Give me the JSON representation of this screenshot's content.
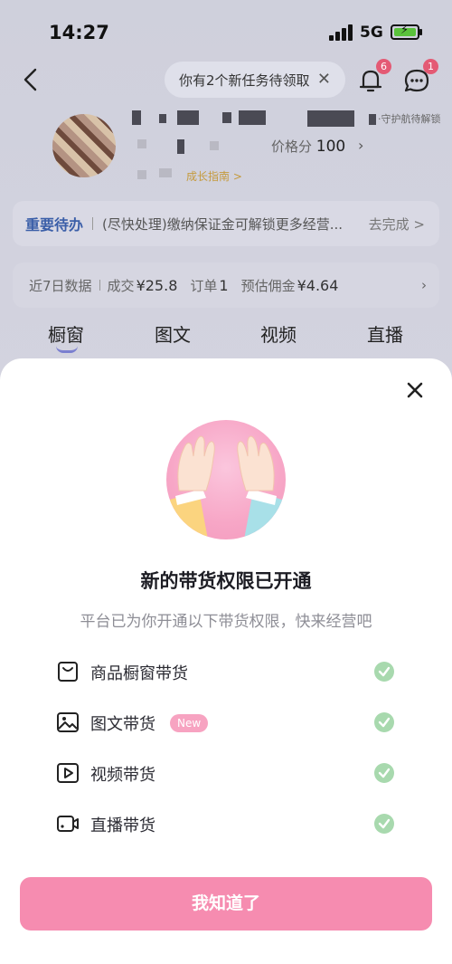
{
  "status_bar": {
    "time": "14:27",
    "network": "5G"
  },
  "header": {
    "task_pill": "你有2个新任务待领取",
    "bell_badge": "6",
    "message_badge": "1"
  },
  "profile": {
    "ambassador": "·守护航待解锁",
    "price_score_label": "价格分",
    "price_score_value": "100",
    "growth_guide": "成长指南 >"
  },
  "todo": {
    "title": "重要待办",
    "text": "(尽快处理)缴纳保证金可解锁更多经营...",
    "action": "去完成 >"
  },
  "stats": {
    "label": "近7日数据",
    "deal_label": "成交",
    "deal_value": "¥25.8",
    "orders_label": "订单",
    "orders_value": "1",
    "commission_label": "预估佣金",
    "commission_value": "¥4.64"
  },
  "tabs": [
    "橱窗",
    "图文",
    "视频",
    "直播"
  ],
  "sheet": {
    "title": "新的带货权限已开通",
    "subtitle": "平台已为你开通以下带货权限，快来经营吧",
    "permissions": [
      {
        "label": "商品橱窗带货",
        "icon": "bag-icon"
      },
      {
        "label": "图文带货",
        "icon": "image-icon",
        "tag": "New"
      },
      {
        "label": "视频带货",
        "icon": "video-play-icon"
      },
      {
        "label": "直播带货",
        "icon": "camera-icon"
      }
    ],
    "confirm_button": "我知道了"
  },
  "colors": {
    "accent_pink": "#f68cb0",
    "check_green": "#a8d9ae",
    "todo_blue": "#3a5ea8"
  }
}
